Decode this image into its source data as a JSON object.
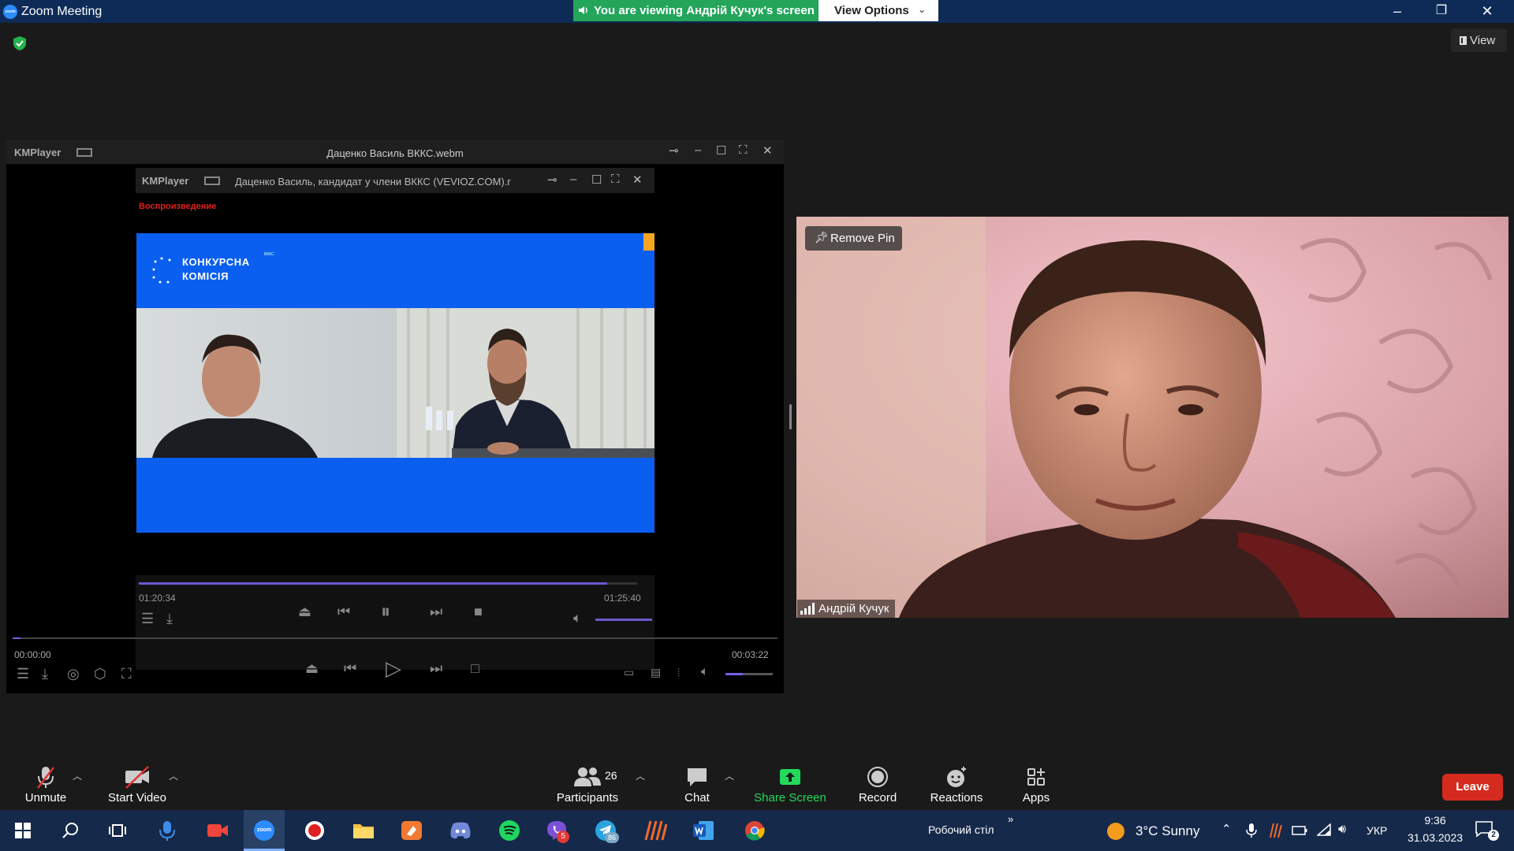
{
  "window": {
    "logo_text": "zoom",
    "title": "Zoom Meeting",
    "banner": "You are viewing Андрій Кучук's screen",
    "view_options": "View Options",
    "minimize": "–",
    "restore": "❐",
    "close": "✕"
  },
  "meeting": {
    "view_button": "View",
    "share": {
      "outer_player": "KMPlayer",
      "outer_file": "Даценко Василь ВККС.webm",
      "inner_player": "KMPlayer",
      "inner_file": "Даценко Василь,  кандидат у члени ВККС (VEVIOZ.COM).r",
      "status": "Воспроизведение",
      "logo_line1": "КОНКУРСНА",
      "logo_line2": "КОМІСІЯ",
      "logo_sup": "ВККС",
      "inner_elapsed": "01:20:34",
      "inner_total": "01:25:40",
      "inner_progress": 0.94,
      "outer_elapsed": "00:00:00",
      "outer_total": "00:03:22",
      "outer_progress": 0.01,
      "outer_volume": 0.37
    },
    "participant": {
      "remove_pin": "Remove Pin",
      "name": "Андрій Кучук"
    }
  },
  "toolbar": {
    "unmute": "Unmute",
    "start_video": "Start Video",
    "participants_count": "26",
    "participants": "Participants",
    "chat": "Chat",
    "share_screen": "Share Screen",
    "record": "Record",
    "reactions": "Reactions",
    "apps": "Apps",
    "leave": "Leave"
  },
  "taskbar": {
    "desktop_label": "Робочий стіл",
    "weather": "3°C  Sunny",
    "language": "УКР",
    "time": "9:36",
    "date": "31.03.2023",
    "notifications": "2",
    "viber_badge": "5",
    "telegram_badge": "86"
  },
  "colors": {
    "zoom_blue": "#2d8cff",
    "banner_green": "#23a55a",
    "leave_red": "#d52b1e",
    "share_green": "#23d959",
    "taskbar": "#15294a"
  }
}
